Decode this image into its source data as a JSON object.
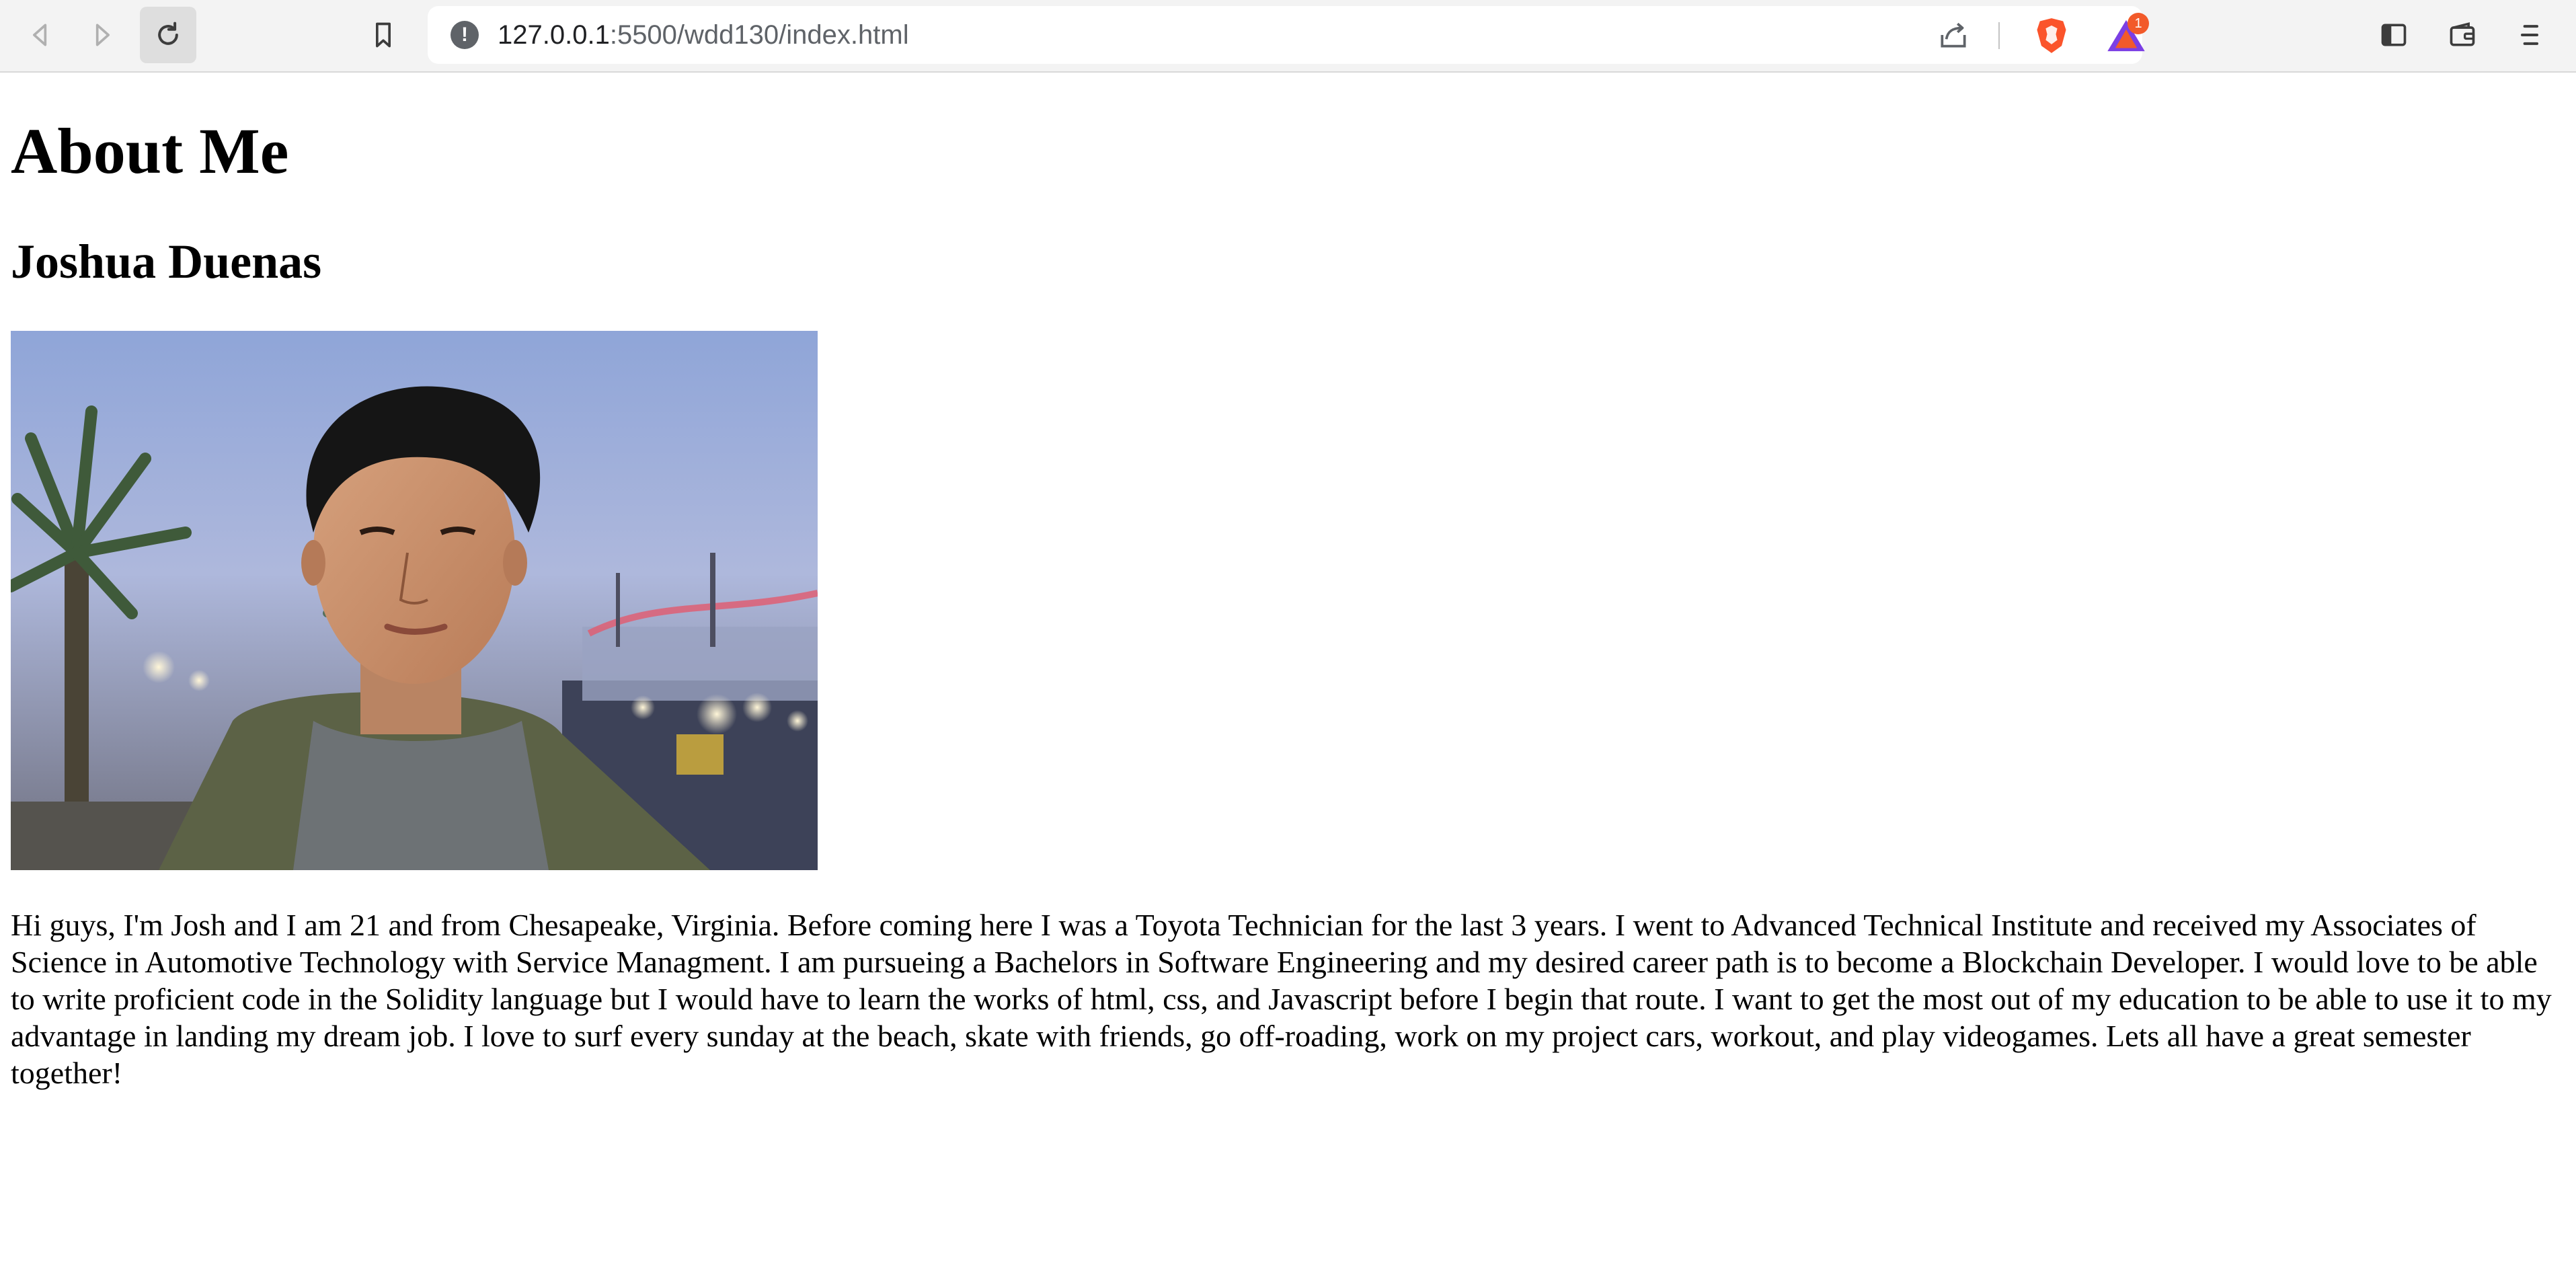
{
  "browser": {
    "url_host": "127.0.0.1",
    "url_path": ":5500/wdd130/index.html",
    "rewards_badge_count": "1",
    "icons": [
      "back-icon",
      "forward-icon",
      "reload-icon",
      "bookmark-icon",
      "site-info-icon",
      "share-icon",
      "brave-shield-icon",
      "brave-rewards-icon",
      "sidebar-icon",
      "wallet-icon",
      "menu-icon"
    ]
  },
  "page": {
    "heading": "About Me",
    "name": "Joshua Duenas",
    "bio": "Hi guys, I'm Josh and I am 21 and from Chesapeake, Virginia. Before coming here I was a Toyota Technician for the last 3 years. I went to Advanced Technical Institute and received my Associates of Science in Automotive Technology with Service Managment. I am pursueing a Bachelors in Software Engineering and my desired career path is to become a Blockchain Developer. I would love to be able to write proficient code in the Solidity language but I would have to learn the works of html, css, and Javascript before I begin that route. I want to get the most out of my education to be able to use it to my advantage in landing my dream job. I love to surf every sunday at the beach, skate with friends, go off-roading, work on my project cars, workout, and play videogames. Lets all have a great semester together!"
  }
}
